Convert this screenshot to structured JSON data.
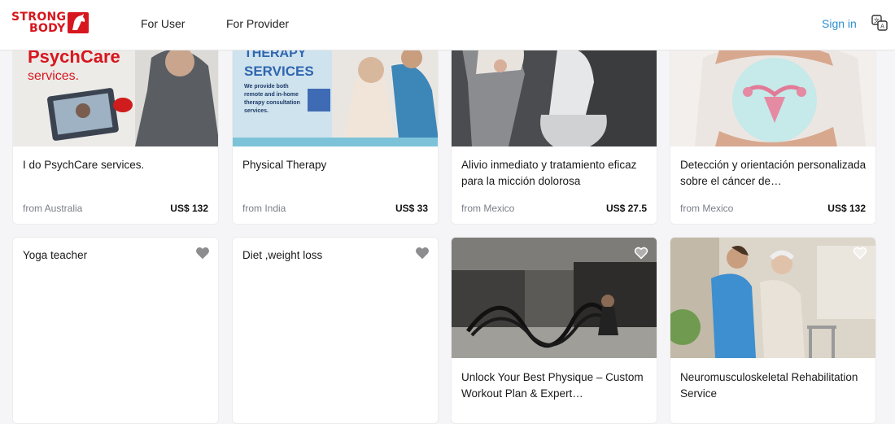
{
  "header": {
    "logo_line1": "STRONG",
    "logo_line2": "BODY",
    "nav_user": "For User",
    "nav_provider": "For Provider",
    "sign_in": "Sign in",
    "language_icon": "translate-icon"
  },
  "colors": {
    "brand": "#d7161e",
    "link": "#2b8fd1"
  },
  "row1": [
    {
      "title": "I do PsychCare services.",
      "from": "from Australia",
      "price": "US$ 132",
      "image_text1": "PsychCare",
      "image_text2": "services."
    },
    {
      "title": "Physical Therapy",
      "from": "from India",
      "price": "US$ 33",
      "image_text1": "THERAPY",
      "image_text2": "SERVICES",
      "image_text3": "We provide both remote and in-home therapy consultation services."
    },
    {
      "title": "Alivio inmediato y tratamiento eficaz para la micción dolorosa",
      "from": "from Mexico",
      "price": "US$ 27.5"
    },
    {
      "title": "Detección y orientación personalizada sobre el cáncer de…",
      "from": "from Mexico",
      "price": "US$ 132"
    }
  ],
  "row2": [
    {
      "title": "Yoga teacher",
      "icon": "heart-icon"
    },
    {
      "title": "Diet ,weight loss",
      "icon": "heart-icon"
    },
    {
      "title": "Unlock Your Best Physique – Custom Workout Plan & Expert…",
      "icon": "heart-icon"
    },
    {
      "title": "Neuromusculoskeletal Rehabilitation Service",
      "icon": "heart-icon"
    }
  ]
}
